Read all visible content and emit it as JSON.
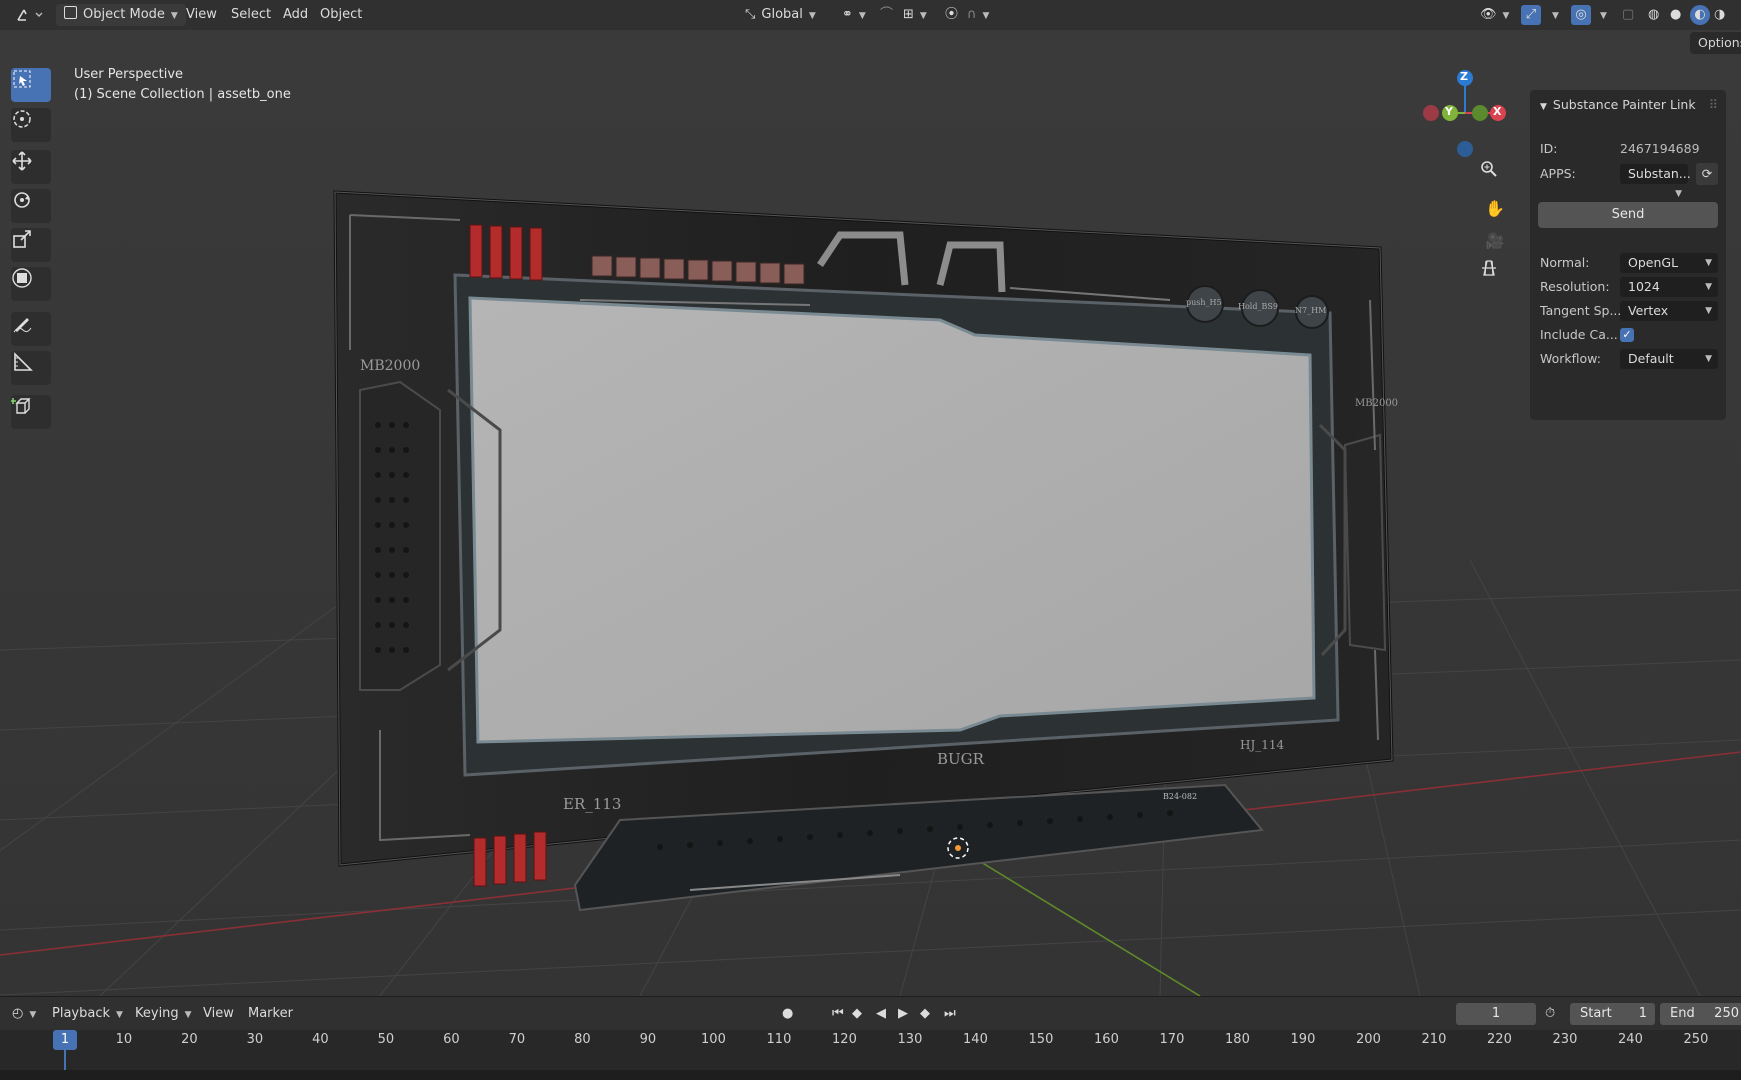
{
  "header": {
    "mode": "Object Mode",
    "menus": [
      "View",
      "Select",
      "Add",
      "Object"
    ],
    "orientation": "Global",
    "options_tab": "Options"
  },
  "viewport": {
    "perspective": "User Perspective",
    "collection": "(1) Scene Collection | assetb_one",
    "axes": {
      "x": "X",
      "y": "Y",
      "z": "Z"
    },
    "model_labels": {
      "left_top": "MB2000",
      "right_top": "MB2000",
      "bottom_left": "ER_113",
      "bottom_center": "BUGR",
      "bottom_right": "HJ_114",
      "knob1": "push_H5",
      "knob2": "Hold_BS9",
      "knob3": "N7_HM",
      "plate": "B24-082"
    }
  },
  "npanel": {
    "title": "Substance Painter Link",
    "id_label": "ID:",
    "id_value": "2467194689",
    "apps_label": "APPS:",
    "apps_value": "Substan...",
    "send_label": "Send",
    "normal_label": "Normal:",
    "normal_value": "OpenGL",
    "resolution_label": "Resolution:",
    "resolution_value": "1024",
    "tangent_label": "Tangent Sp...",
    "tangent_value": "Vertex",
    "include_label": "Include Ca...",
    "include_checked": true,
    "workflow_label": "Workflow:",
    "workflow_value": "Default"
  },
  "timeline": {
    "menus": [
      "Playback",
      "Keying",
      "View",
      "Marker"
    ],
    "current_frame": "1",
    "start_label": "Start",
    "start_value": "1",
    "end_label": "End",
    "end_value": "250",
    "ruler_marks": [
      "1",
      "10",
      "20",
      "30",
      "40",
      "50",
      "60",
      "70",
      "80",
      "90",
      "100",
      "110",
      "120",
      "130",
      "140",
      "150",
      "160",
      "170",
      "180",
      "190",
      "200",
      "210",
      "220",
      "230",
      "240",
      "250"
    ]
  },
  "colors": {
    "accent": "#4772b3",
    "axis_x": "#d8434f",
    "axis_y": "#7fb33a",
    "axis_z": "#2b7bd3",
    "frame_red": "#b32b2b"
  }
}
